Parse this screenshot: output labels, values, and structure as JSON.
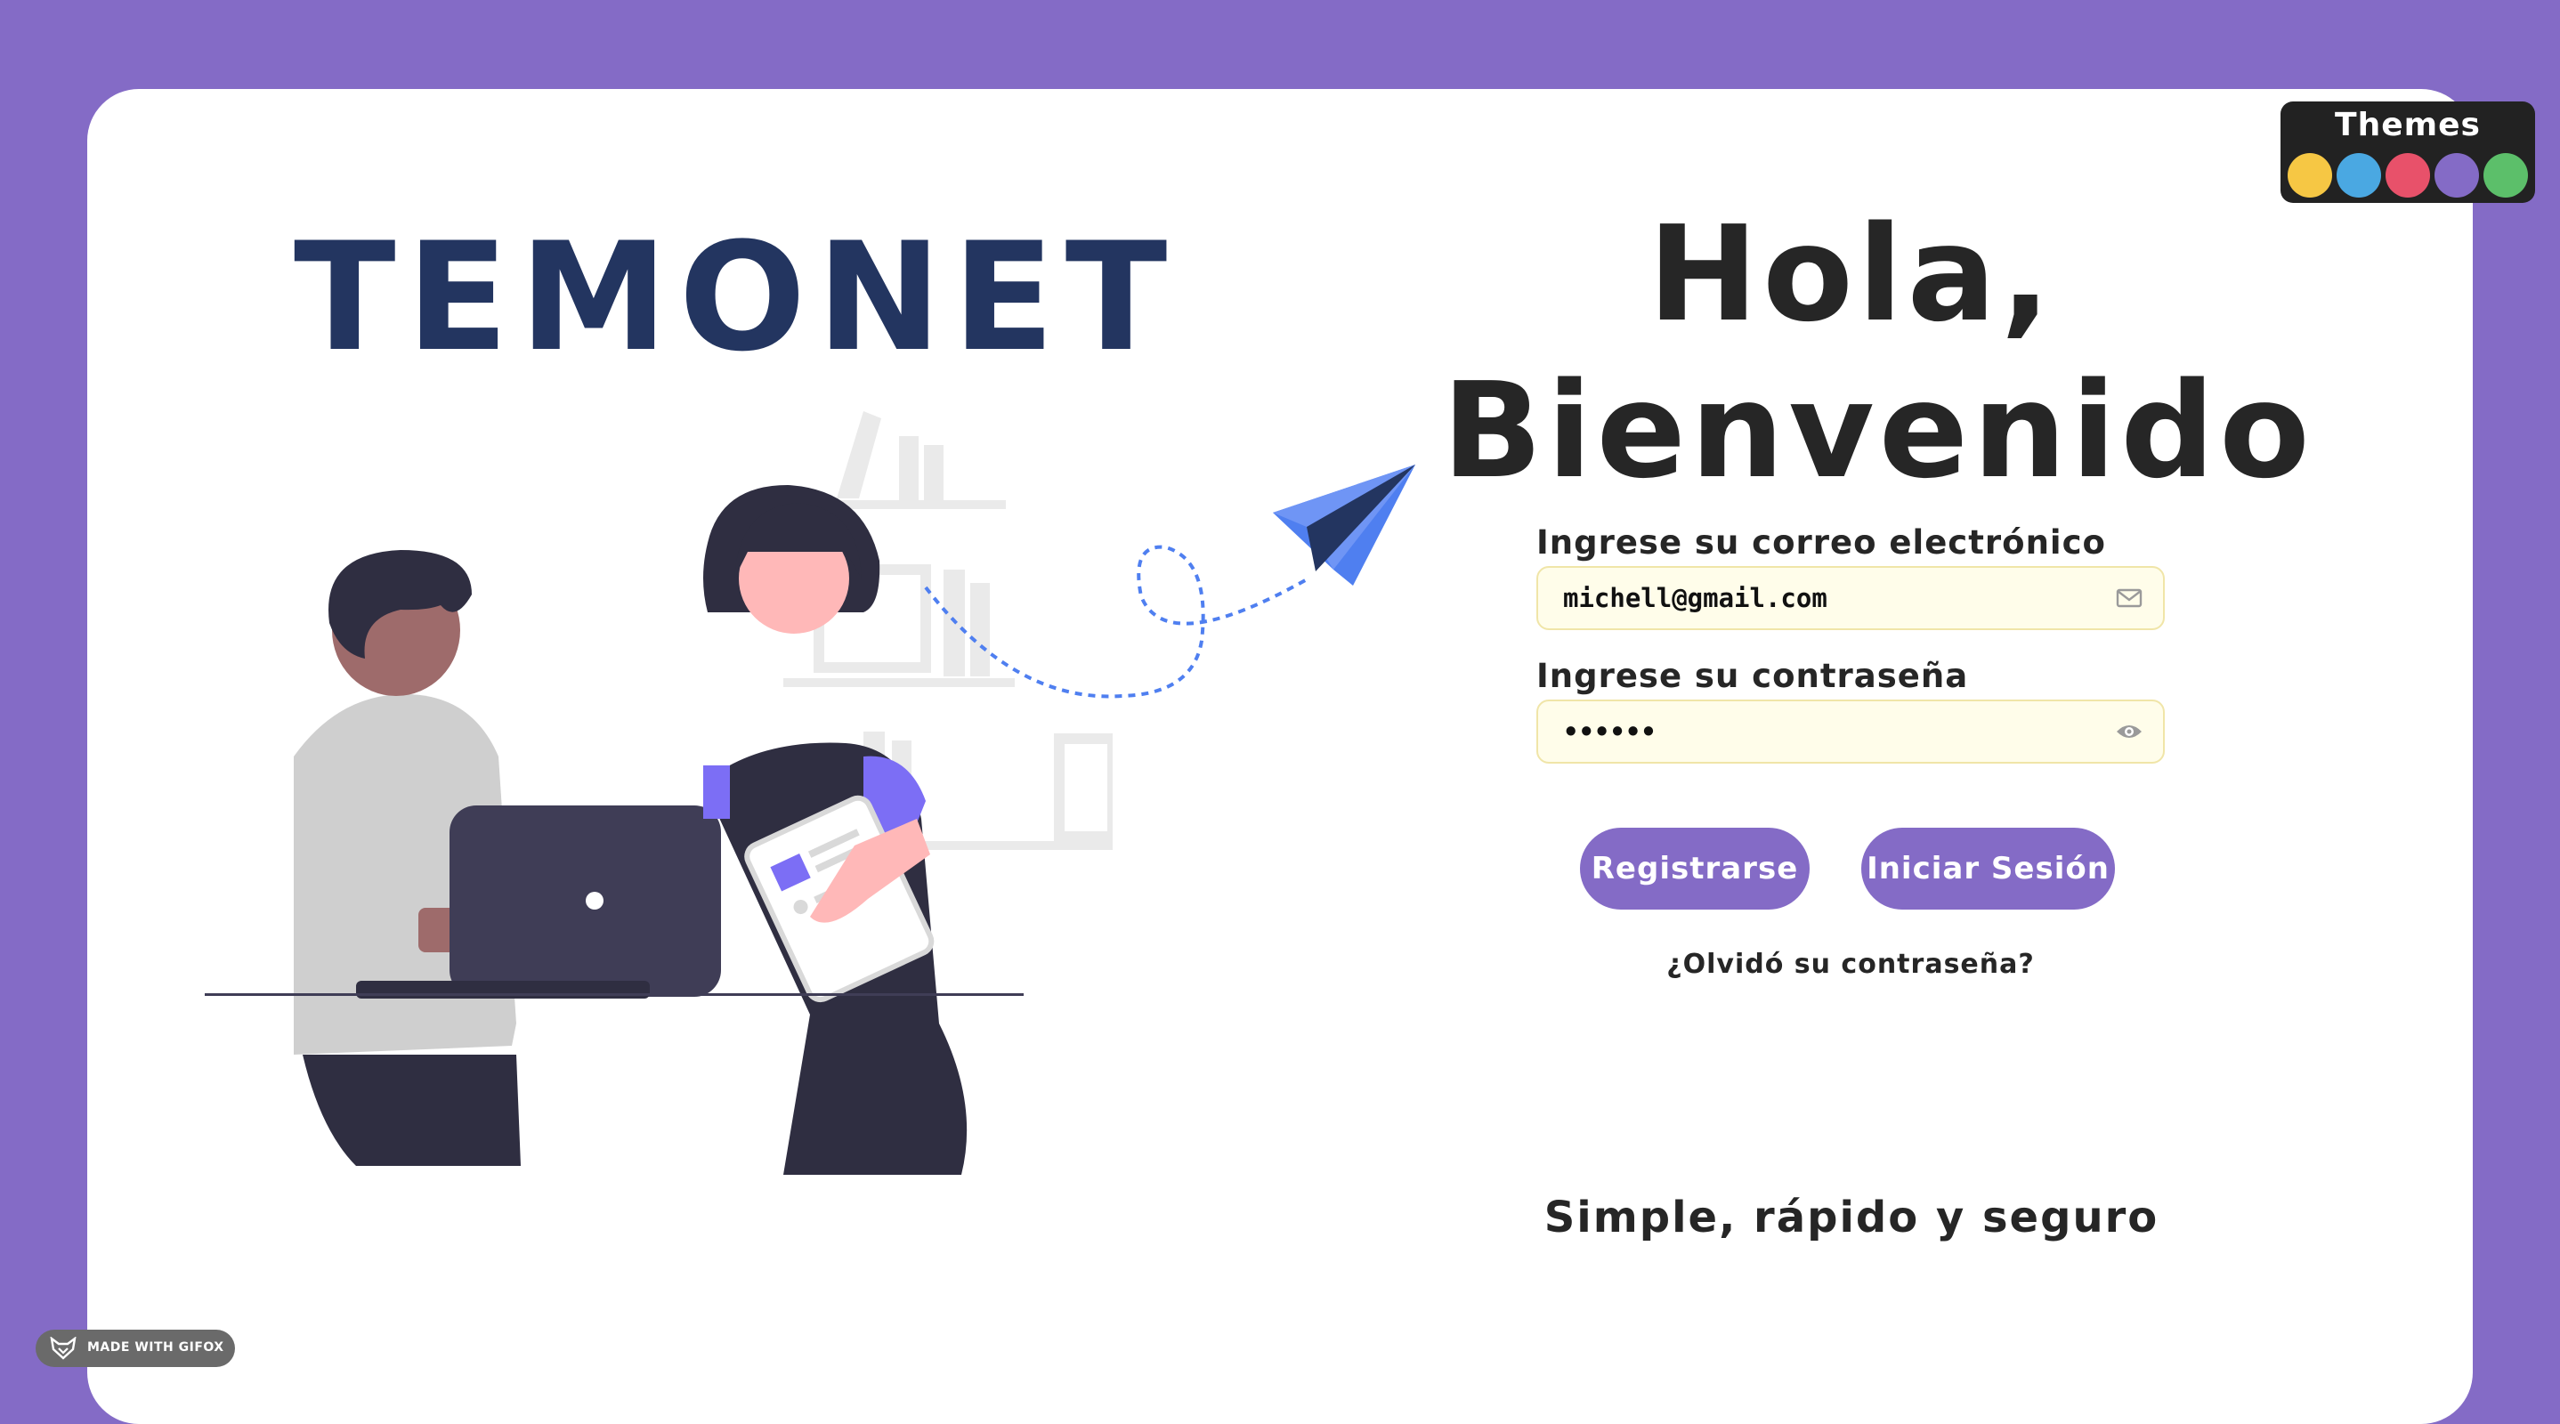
{
  "brand": {
    "name": "TEMONET"
  },
  "greeting": {
    "line1": "Hola,",
    "line2": "Bienvenido"
  },
  "login_form": {
    "email_label": "Ingrese su correo electrónico",
    "email_value": "michell@gmail.com",
    "password_label": "Ingrese su contraseña",
    "password_value": "123456",
    "register_label": "Registrarse",
    "login_label": "Iniciar Sesión",
    "forgot_label": "¿Olvidó su contraseña?"
  },
  "tagline": "Simple, rápido y seguro",
  "themes": {
    "title": "Themes",
    "swatches": [
      {
        "name": "yellow",
        "color": "#f6c744"
      },
      {
        "name": "blue",
        "color": "#4aa8e2"
      },
      {
        "name": "red",
        "color": "#e8516a"
      },
      {
        "name": "purple",
        "color": "#846bc6"
      },
      {
        "name": "green",
        "color": "#5cbf6a"
      }
    ]
  },
  "watermark": {
    "text": "MADE WITH GIFOX"
  },
  "colors": {
    "accent": "#846bc6",
    "brand_text": "#233560",
    "input_bg": "#fffdea",
    "plane": "#4f7ff0"
  },
  "icons": {
    "email_field": "envelope-icon",
    "password_field": "eye-icon",
    "plane": "paper-plane-icon"
  }
}
